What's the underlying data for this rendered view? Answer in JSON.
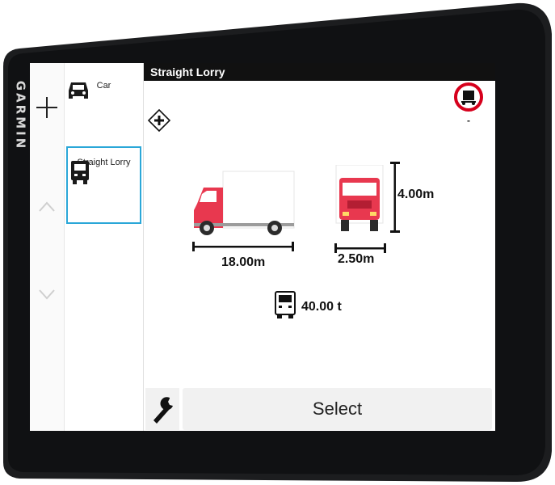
{
  "device": {
    "brand": "GARMIN"
  },
  "sidebar": {
    "items": [
      {
        "label": "Car",
        "icon": "car-icon",
        "selected": false
      },
      {
        "label": "Straight Lorry",
        "icon": "lorry-icon",
        "selected": true
      }
    ]
  },
  "header": {
    "title": "Straight Lorry"
  },
  "vehicle": {
    "length": "18.00m",
    "width": "2.50m",
    "height": "4.00m",
    "weight": "40.00 t",
    "restriction_value": "-"
  },
  "actions": {
    "select_label": "Select"
  },
  "colors": {
    "accent": "#2aa7d8",
    "truck": "#e8384f",
    "restriction": "#d6001c"
  }
}
